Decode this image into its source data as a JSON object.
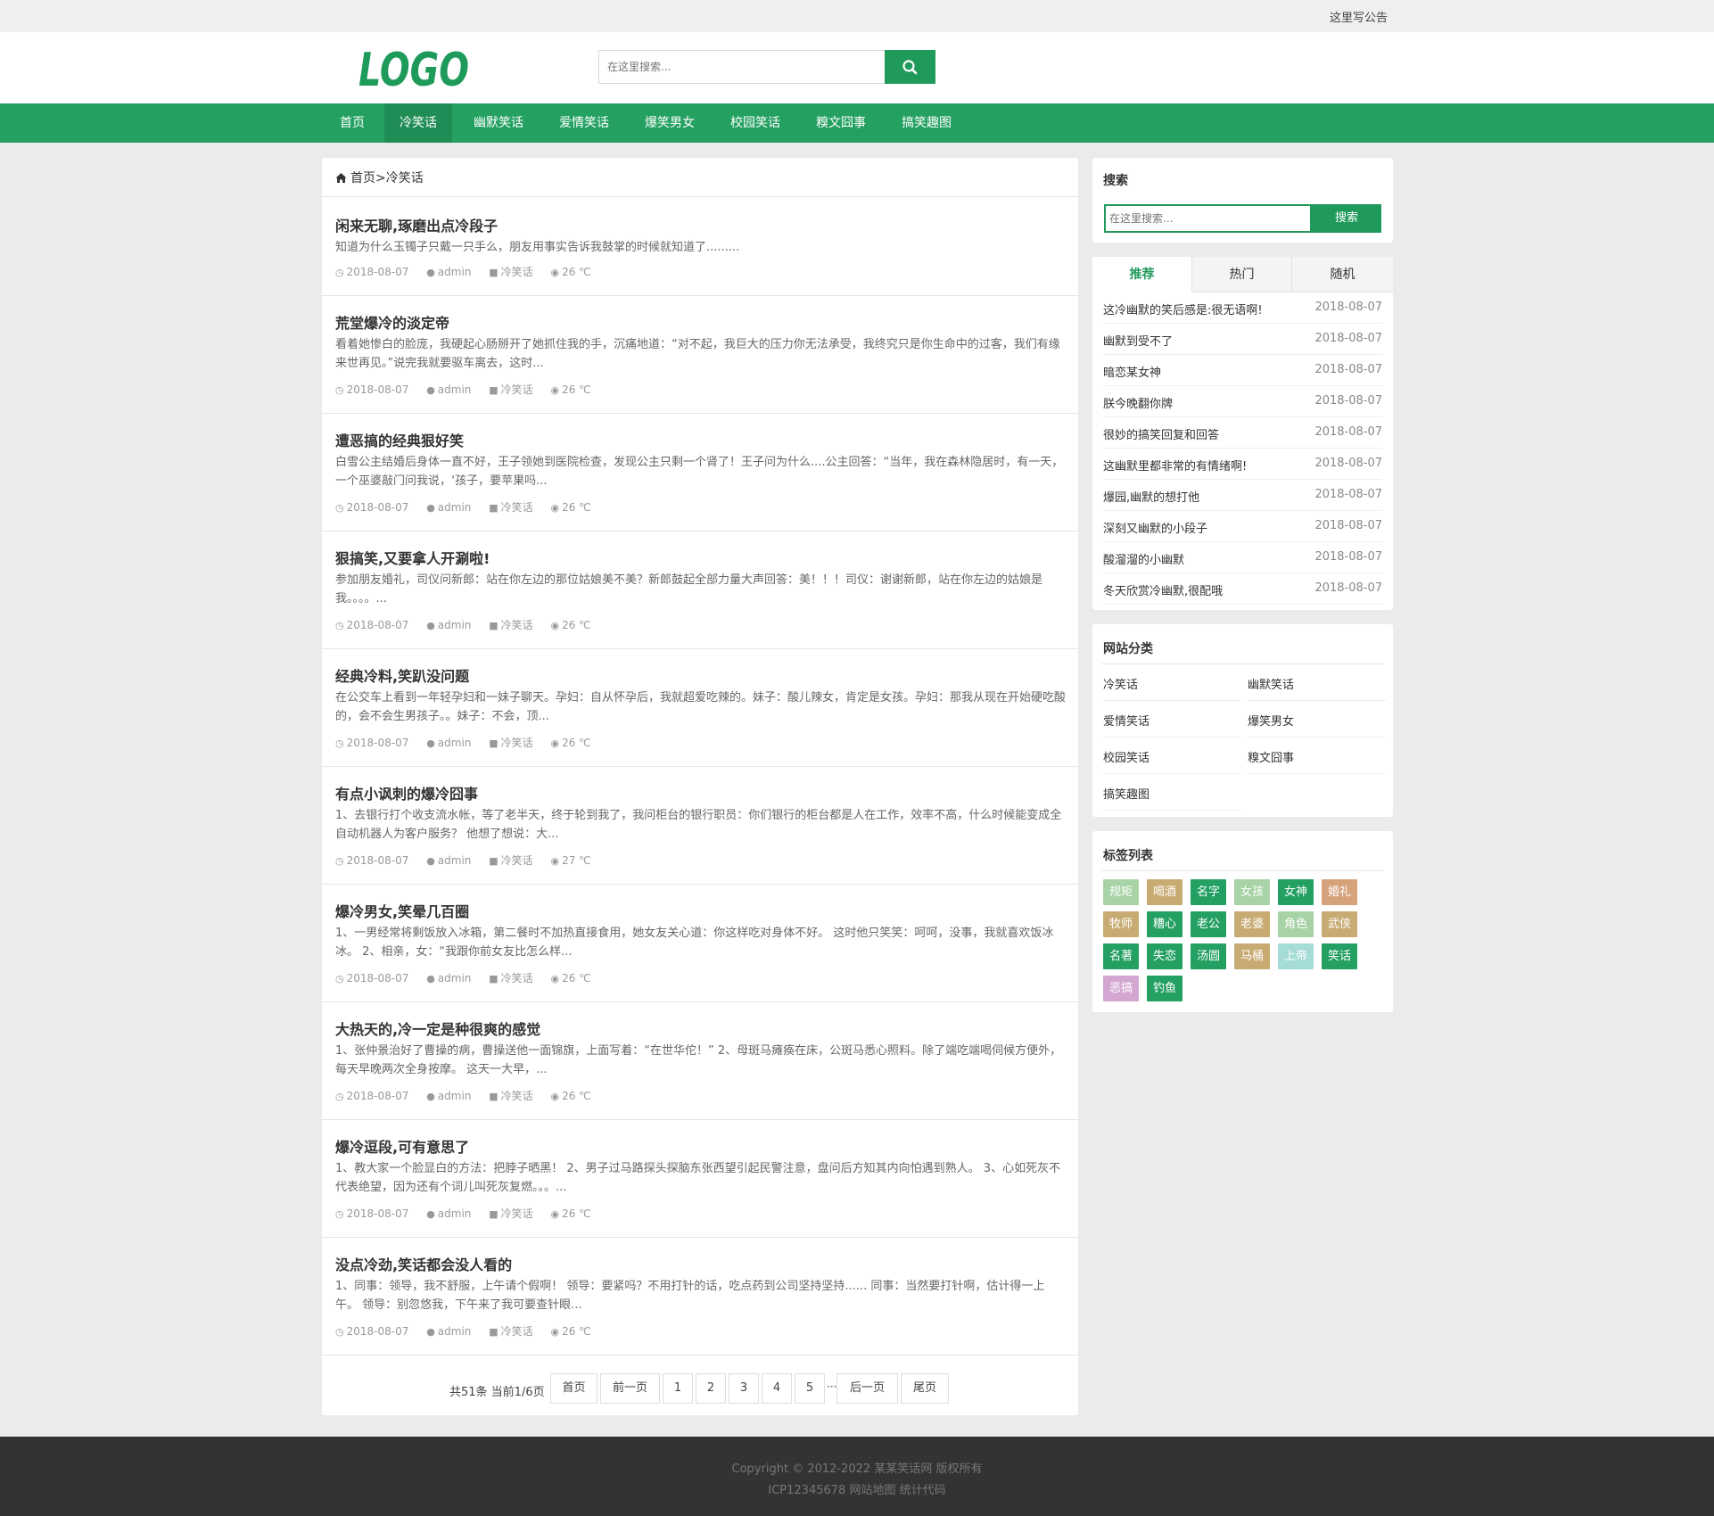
{
  "topbar": {
    "notice": "这里写公告"
  },
  "header": {
    "logo_text": "LOGO",
    "search_placeholder": "在这里搜索..."
  },
  "nav": [
    {
      "label": "首页",
      "active": false
    },
    {
      "label": "冷笑话",
      "active": true
    },
    {
      "label": "幽默笑话",
      "active": false
    },
    {
      "label": "爱情笑话",
      "active": false
    },
    {
      "label": "爆笑男女",
      "active": false
    },
    {
      "label": "校园笑话",
      "active": false
    },
    {
      "label": "糗文囧事",
      "active": false
    },
    {
      "label": "搞笑趣图",
      "active": false
    }
  ],
  "breadcrumb": {
    "home": "首页",
    "sep": ">",
    "current": "冷笑话"
  },
  "articles": [
    {
      "title": "闲来无聊,琢磨出点冷段子",
      "summary": "知道为什么玉镯子只戴一只手么，朋友用事实告诉我鼓掌的时候就知道了.........",
      "date": "2018-08-07",
      "author": "admin",
      "category": "冷笑话",
      "views": "26 ℃"
    },
    {
      "title": "荒堂爆冷的淡定帝",
      "summary": "看着她惨白的脸庞，我硬起心肠掰开了她抓住我的手，沉痛地道：“对不起，我巨大的压力你无法承受，我终究只是你生命中的过客，我们有缘来世再见。”说完我就要驱车离去，这时...",
      "date": "2018-08-07",
      "author": "admin",
      "category": "冷笑话",
      "views": "26 ℃"
    },
    {
      "title": "遭恶搞的经典狠好笑",
      "summary": "白雪公主结婚后身体一直不好，王子领她到医院检查，发现公主只剩一个肾了！王子问为什么....公主回答：“当年，我在森林隐居时，有一天，一个巫婆敲门问我说，‘孩子，要苹果吗...",
      "date": "2018-08-07",
      "author": "admin",
      "category": "冷笑话",
      "views": "26 ℃"
    },
    {
      "title": "狠搞笑,又要拿人开涮啦!",
      "summary": "参加朋友婚礼，司仪问新郎：站在你左边的那位姑娘美不美？新郎鼓起全部力量大声回答：美！！！司仪：谢谢新郎，站在你左边的姑娘是我。。。。...",
      "date": "2018-08-07",
      "author": "admin",
      "category": "冷笑话",
      "views": "26 ℃"
    },
    {
      "title": "经典冷料,笑趴没问题",
      "summary": "在公交车上看到一年轻孕妇和一妹子聊天。孕妇：自从怀孕后，我就超爱吃辣的。妹子：酸儿辣女，肯定是女孩。孕妇：那我从现在开始硬吃酸的，会不会生男孩子。。妹子：不会，顶...",
      "date": "2018-08-07",
      "author": "admin",
      "category": "冷笑话",
      "views": "26 ℃"
    },
    {
      "title": "有点小讽刺的爆冷囧事",
      "summary": "1、去银行打个收支流水帐，等了老半天，终于轮到我了，我问柜台的银行职员：你们银行的柜台都是人在工作，效率不高，什么时候能变成全自动机器人为客户服务？ 他想了想说：大...",
      "date": "2018-08-07",
      "author": "admin",
      "category": "冷笑话",
      "views": "27 ℃"
    },
    {
      "title": "爆冷男女,笑晕几百圈",
      "summary": "1、一男经常将剩饭放入冰箱，第二餐时不加热直接食用，她女友关心道：你这样吃对身体不好。 这时他只笑笑：呵呵，没事，我就喜欢饭冰冰。 2、相亲，女：“我跟你前女友比怎么样...",
      "date": "2018-08-07",
      "author": "admin",
      "category": "冷笑话",
      "views": "26 ℃"
    },
    {
      "title": "大热天的,冷一定是种很爽的感觉",
      "summary": "1、张仲景治好了曹操的病，曹操送他一面锦旗，上面写着：“在世华佗！” 2、母斑马瘫痪在床，公斑马悉心照料。除了端吃端喝伺候方便外，每天早晚两次全身按摩。 这天一大早，...",
      "date": "2018-08-07",
      "author": "admin",
      "category": "冷笑话",
      "views": "26 ℃"
    },
    {
      "title": "爆冷逗段,可有意思了",
      "summary": "1、教大家一个脸显白的方法：把脖子晒黑！ 2、男子过马路探头探脑东张西望引起民警注意，盘问后方知其内向怕遇到熟人。 3、心如死灰不代表绝望，因为还有个词儿叫死灰复燃。。。...",
      "date": "2018-08-07",
      "author": "admin",
      "category": "冷笑话",
      "views": "26 ℃"
    },
    {
      "title": "没点冷劲,笑话都会没人看的",
      "summary": "1、同事：领导，我不舒服，上午请个假啊！ 领导：要紧吗？不用打针的话，吃点药到公司坚持坚持...... 同事：当然要打针啊，估计得一上午。 领导：别忽悠我，下午来了我可要查针眼...",
      "date": "2018-08-07",
      "author": "admin",
      "category": "冷笑话",
      "views": "26 ℃"
    }
  ],
  "pagination": {
    "info": "共51条 当前1/6页",
    "first": "首页",
    "prev": "前一页",
    "pages": [
      "1",
      "2",
      "3",
      "4",
      "5"
    ],
    "dots": "···",
    "next": "后一页",
    "last": "尾页"
  },
  "sidebar": {
    "search": {
      "title": "搜索",
      "placeholder": "在这里搜索...",
      "button": "搜索"
    },
    "tabs": [
      "推荐",
      "热门",
      "随机"
    ],
    "rank": [
      {
        "title": "这冷幽默的笑后感是:很无语啊!",
        "date": "2018-08-07"
      },
      {
        "title": "幽默到受不了",
        "date": "2018-08-07"
      },
      {
        "title": "暗恋某女神",
        "date": "2018-08-07"
      },
      {
        "title": "朕今晚翻你牌",
        "date": "2018-08-07"
      },
      {
        "title": "很妙的搞笑回复和回答",
        "date": "2018-08-07"
      },
      {
        "title": "这幽默里都非常的有情绪啊!",
        "date": "2018-08-07"
      },
      {
        "title": "爆园,幽默的想打他",
        "date": "2018-08-07"
      },
      {
        "title": "深刻又幽默的小段子",
        "date": "2018-08-07"
      },
      {
        "title": "酸溜溜的小幽默",
        "date": "2018-08-07"
      },
      {
        "title": "冬天欣赏冷幽默,很配哦",
        "date": "2018-08-07"
      }
    ],
    "categories_title": "网站分类",
    "categories": [
      "冷笑话",
      "幽默笑话",
      "爱情笑话",
      "爆笑男女",
      "校园笑话",
      "糗文囧事",
      "搞笑趣图"
    ],
    "tags_title": "标签列表",
    "tags": [
      {
        "label": "规矩",
        "color": "#a8d3a6"
      },
      {
        "label": "喝酒",
        "color": "#c8ab73"
      },
      {
        "label": "名字",
        "color": "#23a062"
      },
      {
        "label": "女孩",
        "color": "#a8d3a6"
      },
      {
        "label": "女神",
        "color": "#23a062"
      },
      {
        "label": "婚礼",
        "color": "#d5a27c"
      },
      {
        "label": "牧师",
        "color": "#c8ab73"
      },
      {
        "label": "糟心",
        "color": "#23a062"
      },
      {
        "label": "老公",
        "color": "#23a062"
      },
      {
        "label": "老婆",
        "color": "#c8ab73"
      },
      {
        "label": "角色",
        "color": "#a8d3a6"
      },
      {
        "label": "武侠",
        "color": "#c8ab73"
      },
      {
        "label": "名著",
        "color": "#23a062"
      },
      {
        "label": "失恋",
        "color": "#23a062"
      },
      {
        "label": "汤圆",
        "color": "#23a062"
      },
      {
        "label": "马桶",
        "color": "#c8ab73"
      },
      {
        "label": "上帝",
        "color": "#a6dcd7"
      },
      {
        "label": "笑话",
        "color": "#23a062"
      },
      {
        "label": "恶搞",
        "color": "#d4a7d2"
      },
      {
        "label": "钓鱼",
        "color": "#23a062"
      }
    ]
  },
  "footer": {
    "copyright": "Copyright © 2012-2022 某某笑话网 版权所有",
    "icp": "ICP12345678",
    "sitemap": "网站地图",
    "stats": "统计代码"
  },
  "colors": {
    "brand_green": "#24a161",
    "nav_active": "#1f8d55",
    "footer_bg": "#323334"
  }
}
